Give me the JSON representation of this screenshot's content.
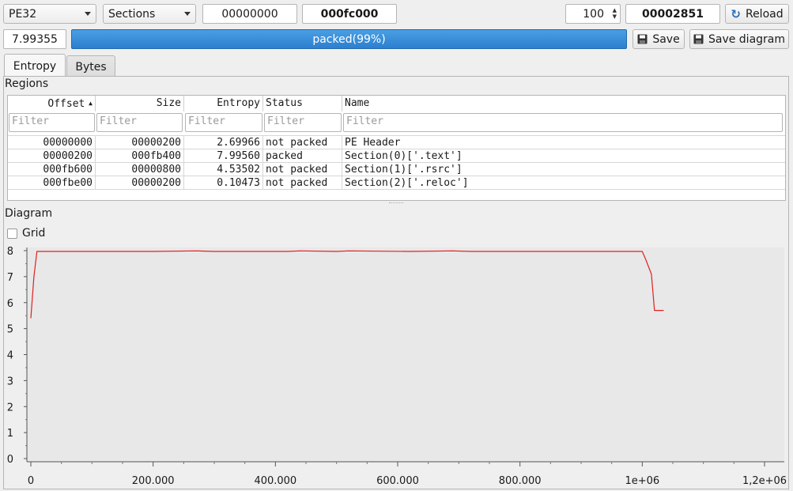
{
  "toolbar": {
    "format": "PE32",
    "mode": "Sections",
    "start_offset": "00000000",
    "end_offset": "000fc000",
    "block_count": "100",
    "block_size": "00002851",
    "reload_label": "Reload"
  },
  "status": {
    "total_entropy": "7.99355",
    "progress_text": "packed(99%)",
    "progress": 0.99,
    "save_label": "Save",
    "save_diagram_label": "Save diagram"
  },
  "tabs": [
    {
      "label": "Entropy",
      "active": true
    },
    {
      "label": "Bytes",
      "active": false
    }
  ],
  "regions": {
    "title": "Regions",
    "columns": [
      "Offset",
      "Size",
      "Entropy",
      "Status",
      "Name"
    ],
    "filter_placeholder": "Filter",
    "rows": [
      {
        "offset": "00000000",
        "size": "00000200",
        "entropy": "2.69966",
        "status": "not packed",
        "name": "PE Header"
      },
      {
        "offset": "00000200",
        "size": "000fb400",
        "entropy": "7.99560",
        "status": "packed",
        "name": "Section(0)['.text']"
      },
      {
        "offset": "000fb600",
        "size": "00000800",
        "entropy": "4.53502",
        "status": "not packed",
        "name": "Section(1)['.rsrc']"
      },
      {
        "offset": "000fbe00",
        "size": "00000200",
        "entropy": "0.10473",
        "status": "not packed",
        "name": "Section(2)['.reloc']"
      }
    ]
  },
  "diagram": {
    "title": "Diagram",
    "grid_label": "Grid",
    "grid_checked": false
  },
  "chart_data": {
    "type": "line",
    "xlim": [
      0,
      1200000
    ],
    "ylim": [
      0,
      8
    ],
    "x_ticks": [
      0,
      200000,
      400000,
      600000,
      800000,
      1000000,
      1200000
    ],
    "x_tick_labels": [
      "0",
      "200.000",
      "400.000",
      "600.000",
      "800.000",
      "1e+06",
      "1,2e+06"
    ],
    "y_ticks": [
      0,
      1,
      2,
      3,
      4,
      5,
      6,
      7,
      8
    ],
    "y_tick_labels": [
      "0",
      "1",
      "2",
      "3",
      "4",
      "5",
      "6",
      "7",
      "8"
    ],
    "line_color": "#e02020",
    "series": [
      {
        "x": [
          0,
          5000,
          10000,
          100000,
          200000,
          270000,
          300000,
          420000,
          440000,
          500000,
          520000,
          620000,
          690000,
          720000,
          900000,
          1000000,
          1005000,
          1015000,
          1020000,
          1030000,
          1035000
        ],
        "y": [
          5.4,
          7.0,
          7.97,
          7.97,
          7.97,
          7.99,
          7.97,
          7.97,
          7.99,
          7.97,
          7.99,
          7.97,
          7.99,
          7.97,
          7.97,
          7.97,
          7.7,
          7.1,
          5.7,
          5.7,
          5.7
        ]
      }
    ]
  }
}
